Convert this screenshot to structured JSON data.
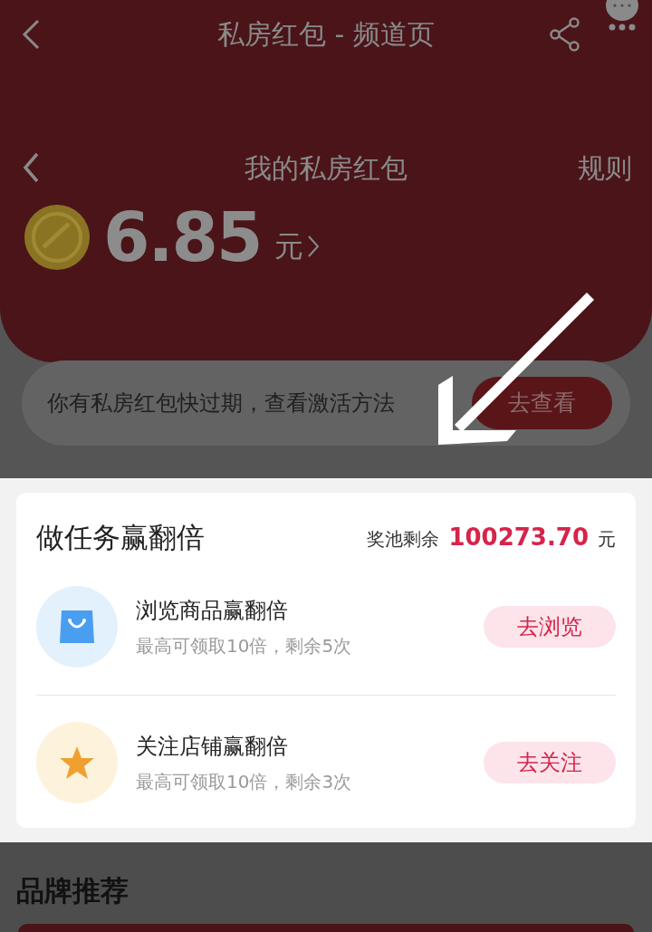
{
  "header": {
    "title": "私房红包 - 频道页"
  },
  "subheader": {
    "title": "我的私房红包",
    "rules": "规则"
  },
  "balance": {
    "amount": "6.85",
    "unit": "元"
  },
  "notice": {
    "text": "你有私房红包快过期，查看激活方法",
    "button": "去查看"
  },
  "tasks": {
    "title": "做任务赢翻倍",
    "pool_label": "奖池剩余",
    "pool_amount": "100273.70",
    "pool_unit": "元",
    "items": [
      {
        "kind": "bag",
        "title": "浏览商品赢翻倍",
        "subtitle": "最高可领取10倍，剩余5次",
        "button": "去浏览"
      },
      {
        "kind": "star",
        "title": "关注店铺赢翻倍",
        "subtitle": "最高可领取10倍，剩余3次",
        "button": "去关注"
      }
    ]
  },
  "brands": {
    "title": "品牌推荐"
  }
}
